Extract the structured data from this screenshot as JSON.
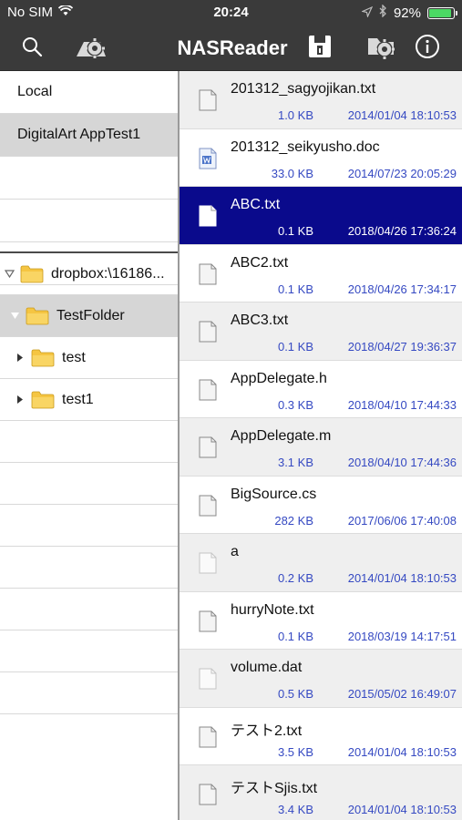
{
  "status_bar": {
    "carrier": "No SIM",
    "time": "20:24",
    "battery_percent": "92%",
    "battery_level": 0.92
  },
  "nav": {
    "title": "NASReader",
    "icons": [
      "search-icon",
      "server-settings-icon",
      "save-icon",
      "settings-icon",
      "info-icon"
    ]
  },
  "servers": [
    {
      "label": "Local",
      "selected": false
    },
    {
      "label": "DigitalArt AppTest1",
      "selected": true
    }
  ],
  "tree": [
    {
      "label": "dropbox:\\16186...",
      "expanded": true,
      "level": 0,
      "selected": false
    },
    {
      "label": "TestFolder",
      "expanded": true,
      "level": 1,
      "selected": true
    },
    {
      "label": "test",
      "expanded": false,
      "level": 1,
      "selected": false
    },
    {
      "label": "test1",
      "expanded": false,
      "level": 1,
      "selected": false
    }
  ],
  "files": [
    {
      "name": "201312_sagyojikan.txt",
      "size": "1.0 KB",
      "date": "2014/01/04 18:10:53",
      "icon": "text-file-icon"
    },
    {
      "name": "201312_seikyusho.doc",
      "size": "33.0 KB",
      "date": "2014/07/23 20:05:29",
      "icon": "word-file-icon"
    },
    {
      "name": "ABC.txt",
      "size": "0.1 KB",
      "date": "2018/04/26 17:36:24",
      "icon": "text-file-icon",
      "selected": true
    },
    {
      "name": "ABC2.txt",
      "size": "0.1 KB",
      "date": "2018/04/26 17:34:17",
      "icon": "text-file-icon"
    },
    {
      "name": "ABC3.txt",
      "size": "0.1 KB",
      "date": "2018/04/27 19:36:37",
      "icon": "text-file-icon"
    },
    {
      "name": "AppDelegate.h",
      "size": "0.3 KB",
      "date": "2018/04/10 17:44:33",
      "icon": "text-file-icon"
    },
    {
      "name": "AppDelegate.m",
      "size": "3.1 KB",
      "date": "2018/04/10 17:44:36",
      "icon": "text-file-icon"
    },
    {
      "name": "BigSource.cs",
      "size": "282 KB",
      "date": "2017/06/06 17:40:08",
      "icon": "text-file-icon"
    },
    {
      "name": "a",
      "size": "0.2 KB",
      "date": "2014/01/04 18:10:53",
      "icon": "blank-file-icon"
    },
    {
      "name": "hurryNote.txt",
      "size": "0.1 KB",
      "date": "2018/03/19 14:17:51",
      "icon": "text-file-icon"
    },
    {
      "name": "volume.dat",
      "size": "0.5 KB",
      "date": "2015/05/02 16:49:07",
      "icon": "blank-file-icon"
    },
    {
      "name": "テスト2.txt",
      "size": "3.5 KB",
      "date": "2014/01/04 18:10:53",
      "icon": "text-file-icon"
    },
    {
      "name": "テストSjis.txt",
      "size": "3.4 KB",
      "date": "2014/01/04 18:10:53",
      "icon": "text-file-icon"
    }
  ],
  "colors": {
    "bar_background": "#3a3a3a",
    "selection": "#0a0a8c",
    "meta_text": "#3549c2",
    "battery": "#4cd964",
    "folder": "#f5c542"
  }
}
